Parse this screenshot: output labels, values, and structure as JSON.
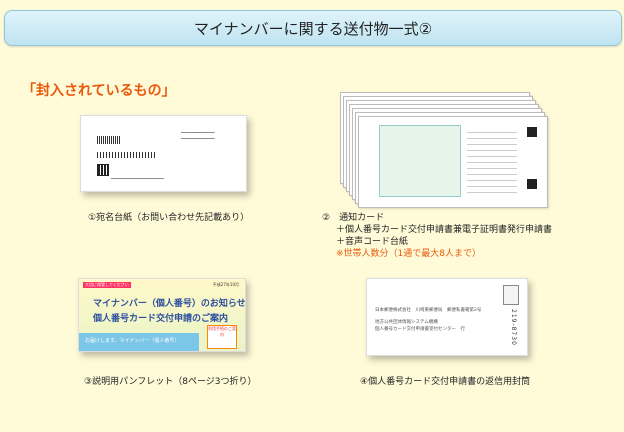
{
  "header": {
    "title": "マイナンバーに関する送付物一式②"
  },
  "section": {
    "heading": "「封入されているもの」"
  },
  "items": [
    {
      "caption": "①宛名台紙（お問い合わせ先記載あり）"
    },
    {
      "caption_line1": "②　通知カード",
      "caption_line2": "＋個人番号カード交付申請書兼電子証明書発行申請書",
      "caption_line3": "＋音声コード台紙",
      "caption_note": "※世帯人数分（1通で最大8人まで）"
    },
    {
      "caption": "③説明用パンフレット（8ページ3つ折り）",
      "pamphlet": {
        "tag": "大切に保管してください",
        "date": "平成27年10月",
        "heading1": "マイナンバー（個人番号）のお知らせ",
        "heading2": "個人番号カード交付申請のご案内",
        "band": "お届けします。マイナンバー（個人番号）",
        "badge": "利用手続のご案内"
      }
    },
    {
      "caption": "④個人番号カード交付申請書の返信用封筒",
      "envelope": {
        "line1": "日本郵便株式会社　川崎東郵便局　郵便私書箱第2号",
        "line2": "地方公共団体情報システム機構",
        "line3": "個人番号カード交付申請書受付センター　行",
        "postal": "219-8730"
      }
    }
  ],
  "colors": {
    "accent": "#e8590c",
    "title_bg": "#cdeaf5",
    "page_bg": "#fffbd9"
  }
}
